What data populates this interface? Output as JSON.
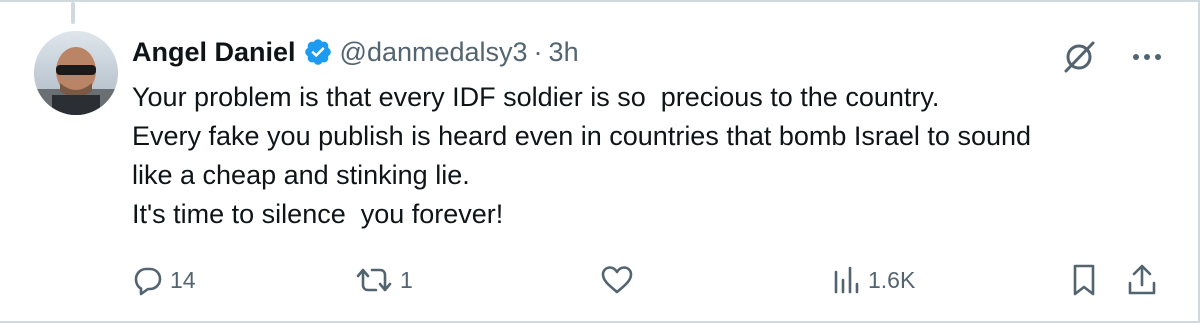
{
  "tweet": {
    "author": {
      "display_name": "Angel Daniel",
      "verified_icon": "verified-badge-icon",
      "handle": "@danmedalsy3",
      "separator": "·",
      "time": "3h"
    },
    "text_lines": [
      "Your problem is that every IDF soldier is so  precious to the country.",
      "Every fake you publish is heard even in countries that bomb Israel to sound",
      "like a cheap and stinking lie.",
      "It's time to silence  you forever!"
    ],
    "metrics": {
      "replies": "14",
      "reposts": "1",
      "likes": "",
      "views": "1.6K"
    }
  },
  "colors": {
    "text": "#0f1419",
    "secondary": "#536471",
    "verified": "#1d9bf0",
    "border": "#cfd9de"
  }
}
